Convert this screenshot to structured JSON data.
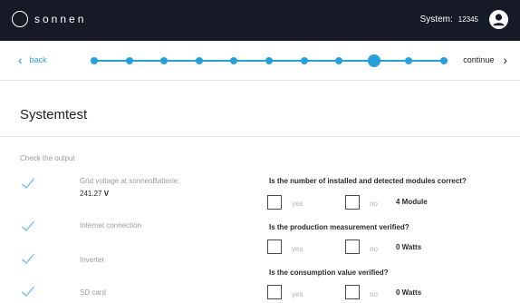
{
  "header": {
    "logo_text": "sonnen",
    "system_label": "System:",
    "system_number": "12345",
    "user_icon": "user-icon"
  },
  "nav": {
    "back_label": "back",
    "continue_label": "continue",
    "step_count": 11,
    "active_step": 9
  },
  "page": {
    "title": "Systemtest",
    "subheading": "Check the output"
  },
  "checks": [
    {
      "label": "Grid voltage at sonnenBatterie:",
      "value_number": "241.27",
      "value_unit": "V",
      "checked": true
    },
    {
      "label": "Internet connection",
      "checked": true
    },
    {
      "label": "Inverter",
      "checked": true
    },
    {
      "label": "SD card",
      "checked": true
    }
  ],
  "questions": [
    {
      "text": "Is the number of installed and detected modules correct?",
      "yes_label": "yes",
      "no_label": "no",
      "value": "4 Module"
    },
    {
      "text": "Is the production measurement verified?",
      "yes_label": "yes",
      "no_label": "no",
      "value": "0 Watts"
    },
    {
      "text": "Is the consumption value verified?",
      "yes_label": "yes",
      "no_label": "no",
      "value": "0 Watts"
    }
  ],
  "colors": {
    "topbar": "#161a26",
    "accent": "#26a0d9",
    "check": "#66b8e6"
  }
}
